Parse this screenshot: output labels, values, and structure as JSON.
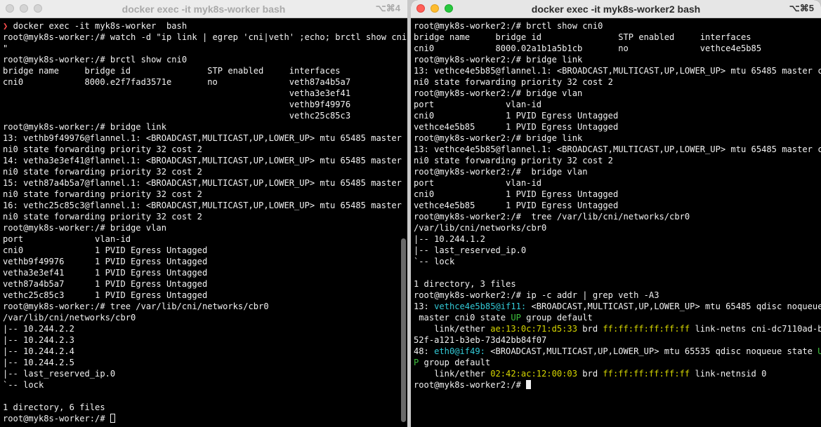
{
  "left": {
    "title": "docker exec -it myk8s-worker bash",
    "shortcut": "⌥⌘4",
    "lines": [
      [
        {
          "t": "❯ ",
          "c": "c-red"
        },
        {
          "t": "docker exec -it myk8s-worker  bash"
        }
      ],
      [
        {
          "t": "root@myk8s-worker:/# watch -d \"ip link | egrep 'cni|veth' ;echo; brctl show cni0"
        }
      ],
      [
        {
          "t": "\""
        }
      ],
      [
        {
          "t": "root@myk8s-worker:/# brctl show cni0"
        }
      ],
      [
        {
          "t": "bridge name     bridge id               STP enabled     interfaces"
        }
      ],
      [
        {
          "t": "cni0            8000.e2f7fad3571e       no              veth87a4b5a7"
        }
      ],
      [
        {
          "t": "                                                        vetha3e3ef41"
        }
      ],
      [
        {
          "t": "                                                        vethb9f49976"
        }
      ],
      [
        {
          "t": "                                                        vethc25c85c3"
        }
      ],
      [
        {
          "t": "root@myk8s-worker:/# bridge link"
        }
      ],
      [
        {
          "t": "13: vethb9f49976@flannel.1: <BROADCAST,MULTICAST,UP,LOWER_UP> mtu 65485 master c"
        }
      ],
      [
        {
          "t": "ni0 state forwarding priority 32 cost 2"
        }
      ],
      [
        {
          "t": "14: vetha3e3ef41@flannel.1: <BROADCAST,MULTICAST,UP,LOWER_UP> mtu 65485 master c"
        }
      ],
      [
        {
          "t": "ni0 state forwarding priority 32 cost 2"
        }
      ],
      [
        {
          "t": "15: veth87a4b5a7@flannel.1: <BROADCAST,MULTICAST,UP,LOWER_UP> mtu 65485 master c"
        }
      ],
      [
        {
          "t": "ni0 state forwarding priority 32 cost 2"
        }
      ],
      [
        {
          "t": "16: vethc25c85c3@flannel.1: <BROADCAST,MULTICAST,UP,LOWER_UP> mtu 65485 master c"
        }
      ],
      [
        {
          "t": "ni0 state forwarding priority 32 cost 2"
        }
      ],
      [
        {
          "t": "root@myk8s-worker:/# bridge vlan"
        }
      ],
      [
        {
          "t": "port              vlan-id"
        }
      ],
      [
        {
          "t": "cni0              1 PVID Egress Untagged"
        }
      ],
      [
        {
          "t": "vethb9f49976      1 PVID Egress Untagged"
        }
      ],
      [
        {
          "t": "vetha3e3ef41      1 PVID Egress Untagged"
        }
      ],
      [
        {
          "t": "veth87a4b5a7      1 PVID Egress Untagged"
        }
      ],
      [
        {
          "t": "vethc25c85c3      1 PVID Egress Untagged"
        }
      ],
      [
        {
          "t": "root@myk8s-worker:/# tree /var/lib/cni/networks/cbr0"
        }
      ],
      [
        {
          "t": "/var/lib/cni/networks/cbr0"
        }
      ],
      [
        {
          "t": "|-- 10.244.2.2"
        }
      ],
      [
        {
          "t": "|-- 10.244.2.3"
        }
      ],
      [
        {
          "t": "|-- 10.244.2.4"
        }
      ],
      [
        {
          "t": "|-- 10.244.2.5"
        }
      ],
      [
        {
          "t": "|-- last_reserved_ip.0"
        }
      ],
      [
        {
          "t": "`-- lock"
        }
      ],
      [
        {
          "t": ""
        }
      ],
      [
        {
          "t": "1 directory, 6 files"
        }
      ],
      [
        {
          "t": "root@myk8s-worker:/# "
        },
        {
          "cursor": "hollow"
        }
      ]
    ]
  },
  "right": {
    "title": "docker exec -it myk8s-worker2 bash",
    "shortcut": "⌥⌘5",
    "lines": [
      [
        {
          "t": "root@myk8s-worker2:/# brctl show cni0"
        }
      ],
      [
        {
          "t": "bridge name     bridge id               STP enabled     interfaces"
        }
      ],
      [
        {
          "t": "cni0            8000.02a1b1a5b1cb       no              vethce4e5b85"
        }
      ],
      [
        {
          "t": "root@myk8s-worker2:/# bridge link"
        }
      ],
      [
        {
          "t": "13: vethce4e5b85@flannel.1: <BROADCAST,MULTICAST,UP,LOWER_UP> mtu 65485 master c"
        }
      ],
      [
        {
          "t": "ni0 state forwarding priority 32 cost 2"
        }
      ],
      [
        {
          "t": "root@myk8s-worker2:/# bridge vlan"
        }
      ],
      [
        {
          "t": "port              vlan-id"
        }
      ],
      [
        {
          "t": "cni0              1 PVID Egress Untagged"
        }
      ],
      [
        {
          "t": "vethce4e5b85      1 PVID Egress Untagged"
        }
      ],
      [
        {
          "t": "root@myk8s-worker2:/# bridge link"
        }
      ],
      [
        {
          "t": "13: vethce4e5b85@flannel.1: <BROADCAST,MULTICAST,UP,LOWER_UP> mtu 65485 master c"
        }
      ],
      [
        {
          "t": "ni0 state forwarding priority 32 cost 2"
        }
      ],
      [
        {
          "t": "root@myk8s-worker2:/#  bridge vlan"
        }
      ],
      [
        {
          "t": "port              vlan-id"
        }
      ],
      [
        {
          "t": "cni0              1 PVID Egress Untagged"
        }
      ],
      [
        {
          "t": "vethce4e5b85      1 PVID Egress Untagged"
        }
      ],
      [
        {
          "t": "root@myk8s-worker2:/#  tree /var/lib/cni/networks/cbr0"
        }
      ],
      [
        {
          "t": "/var/lib/cni/networks/cbr0"
        }
      ],
      [
        {
          "t": "|-- 10.244.1.2"
        }
      ],
      [
        {
          "t": "|-- last_reserved_ip.0"
        }
      ],
      [
        {
          "t": "`-- lock"
        }
      ],
      [
        {
          "t": ""
        }
      ],
      [
        {
          "t": "1 directory, 3 files"
        }
      ],
      [
        {
          "t": "root@myk8s-worker2:/# ip -c addr | grep veth -A3"
        }
      ],
      [
        {
          "t": "13: "
        },
        {
          "t": "vethce4e5b85@if11:",
          "c": "c-cyan"
        },
        {
          "t": " <BROADCAST,MULTICAST,UP,LOWER_UP> mtu 65485 qdisc noqueue"
        }
      ],
      [
        {
          "t": " master cni0 state "
        },
        {
          "t": "UP",
          "c": "c-green"
        },
        {
          "t": " group default"
        }
      ],
      [
        {
          "t": "    link/ether "
        },
        {
          "t": "ae:13:0c:71:d5:33",
          "c": "c-yellow"
        },
        {
          "t": " brd "
        },
        {
          "t": "ff:ff:ff:ff:ff:ff",
          "c": "c-yellow"
        },
        {
          "t": " link-netns cni-dc7110ad-b"
        }
      ],
      [
        {
          "t": "52f-a121-b3eb-73d42bb84f07"
        }
      ],
      [
        {
          "t": "48: "
        },
        {
          "t": "eth0@if49:",
          "c": "c-cyan"
        },
        {
          "t": " <BROADCAST,MULTICAST,UP,LOWER_UP> mtu 65535 qdisc noqueue state "
        },
        {
          "t": "U",
          "c": "c-green"
        }
      ],
      [
        {
          "t": "P",
          "c": "c-green"
        },
        {
          "t": " group default"
        }
      ],
      [
        {
          "t": "    link/ether "
        },
        {
          "t": "02:42:ac:12:00:03",
          "c": "c-yellow"
        },
        {
          "t": " brd "
        },
        {
          "t": "ff:ff:ff:ff:ff:ff",
          "c": "c-yellow"
        },
        {
          "t": " link-netnsid 0"
        }
      ],
      [
        {
          "t": "root@myk8s-worker2:/# "
        },
        {
          "cursor": "solid"
        }
      ]
    ]
  }
}
